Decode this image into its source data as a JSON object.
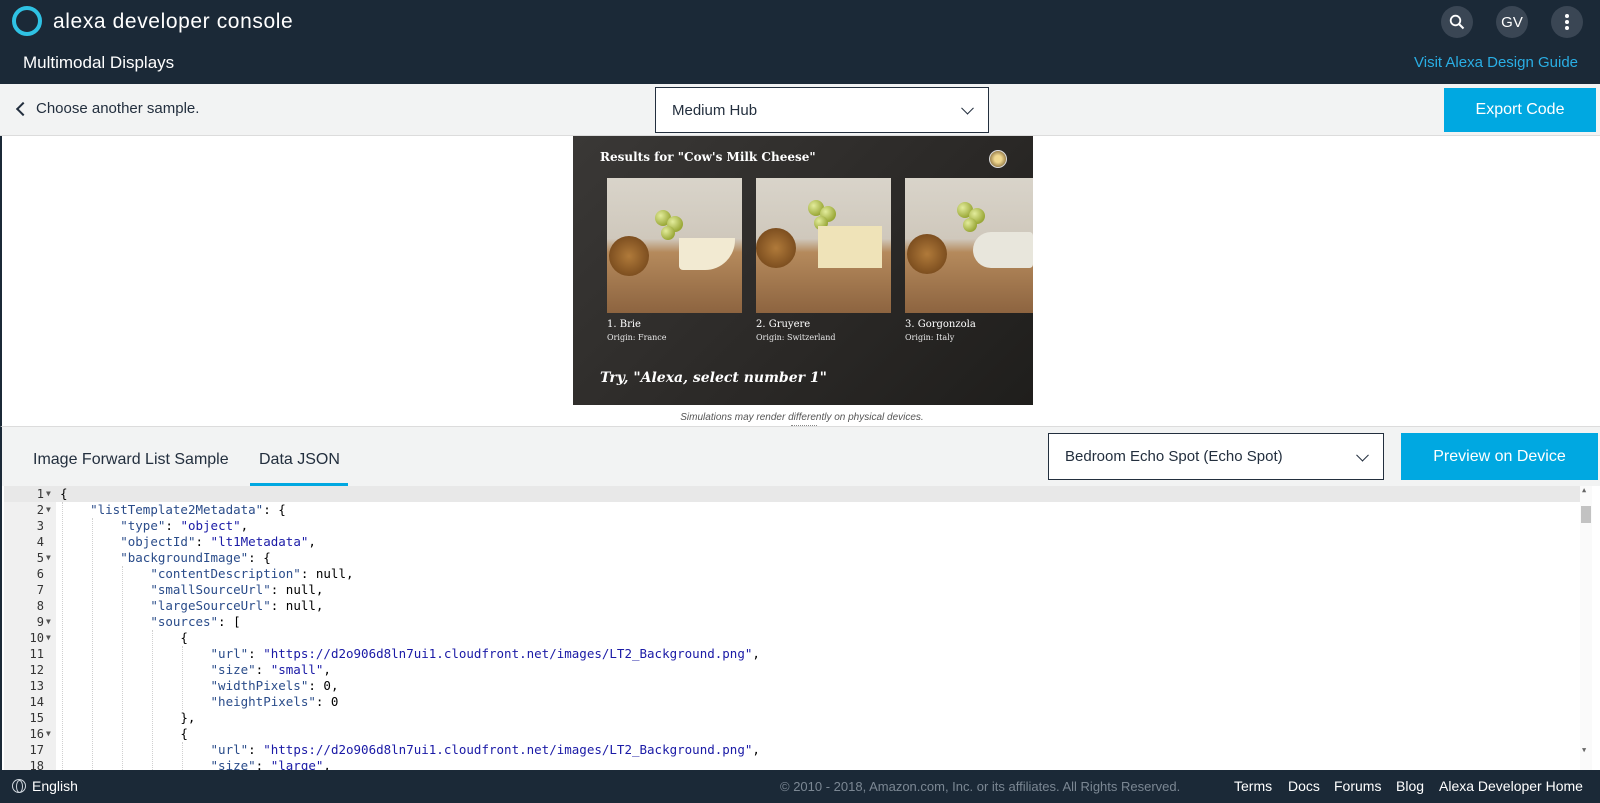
{
  "header": {
    "app_title": "alexa developer console",
    "page_title": "Multimodal Displays",
    "search_label": "⌕",
    "user_initials": "GV",
    "more_label": "⋮",
    "design_guide_link": "Visit Alexa Design Guide"
  },
  "toolbar": {
    "back_label": "Choose another sample.",
    "device_select": "Medium Hub",
    "export_label": "Export Code"
  },
  "simulator": {
    "title": "Results for \"Cow's Milk Cheese\"",
    "items": [
      {
        "name": "1. Brie",
        "origin": "Origin: France"
      },
      {
        "name": "2. Gruyere",
        "origin": "Origin: Switzerland"
      },
      {
        "name": "3. Gorgonzola",
        "origin": "Origin: Italy"
      }
    ],
    "hint": "Try, \"Alexa, select number 1\"",
    "disclaimer": "Simulations may render differently on physical devices."
  },
  "editor_tabs": {
    "tab_sample": "Image Forward List Sample",
    "tab_data": "Data JSON",
    "target_device": "Bedroom Echo Spot (Echo Spot)",
    "preview_label": "Preview on Device"
  },
  "code_lines": [
    "{",
    "    \"listTemplate2Metadata\": {",
    "        \"type\": \"object\",",
    "        \"objectId\": \"lt1Metadata\",",
    "        \"backgroundImage\": {",
    "            \"contentDescription\": null,",
    "            \"smallSourceUrl\": null,",
    "            \"largeSourceUrl\": null,",
    "            \"sources\": [",
    "                {",
    "                    \"url\": \"https://d2o906d8ln7ui1.cloudfront.net/images/LT2_Background.png\",",
    "                    \"size\": \"small\",",
    "                    \"widthPixels\": 0,",
    "                    \"heightPixels\": 0",
    "                },",
    "                {",
    "                    \"url\": \"https://d2o906d8ln7ui1.cloudfront.net/images/LT2_Background.png\",",
    "                    \"size\": \"large\","
  ],
  "footer": {
    "language": "English",
    "copyright": "© 2010 - 2018, Amazon.com, Inc. or its affiliates. All Rights Reserved.",
    "links": [
      "Terms",
      "Docs",
      "Forums",
      "Blog",
      "Alexa Developer Home"
    ]
  }
}
